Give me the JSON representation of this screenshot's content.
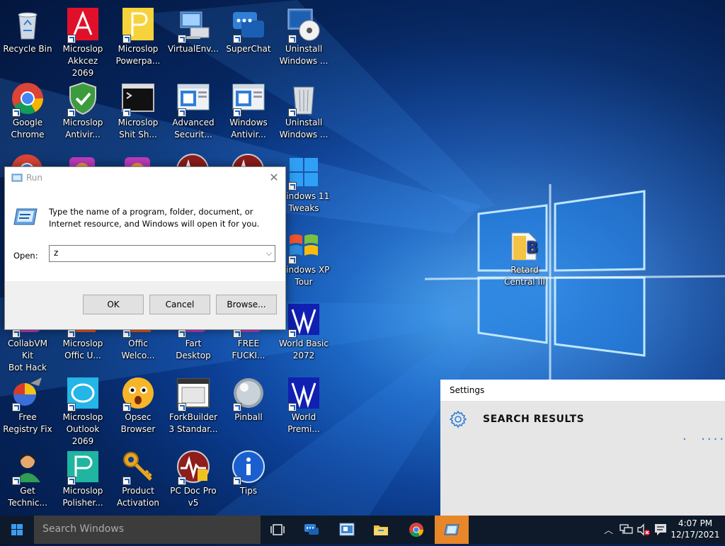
{
  "desktop": {
    "icons": [
      {
        "label": "Recycle Bin",
        "icon": "recycle-bin-icon"
      },
      {
        "label": "Microslop\nAkkcez 2069",
        "icon": "access-icon"
      },
      {
        "label": "Microslop\nPowerpa...",
        "icon": "powerpoint-icon"
      },
      {
        "label": "VirtualEnv...",
        "icon": "computer-icon"
      },
      {
        "label": "SuperChat",
        "icon": "chat-icon"
      },
      {
        "label": "Uninstall\nWindows ...",
        "icon": "uninstall-cd-icon"
      },
      {
        "label": "Google\nChrome",
        "icon": "chrome-icon"
      },
      {
        "label": "Microslop\nAntivir...",
        "icon": "shield-icon"
      },
      {
        "label": "Microslop\nShit Sh...",
        "icon": "terminal-icon"
      },
      {
        "label": "Advanced\nSecurit...",
        "icon": "window-app-icon"
      },
      {
        "label": "Windows\nAntivir...",
        "icon": "window-app-icon"
      },
      {
        "label": "Uninstall\nWindows ...",
        "icon": "trash-can-icon"
      },
      {
        "label": "Windows 11\nTweaks",
        "icon": "windows-logo-icon"
      },
      {
        "label": "Windows XP\nTour",
        "icon": "windows-xp-logo-icon"
      },
      {
        "label": "CollabVM Kit\nBot Hack",
        "icon": "app-icon"
      },
      {
        "label": "Microslop\nOffic U...",
        "icon": "office-icon"
      },
      {
        "label": "Offic\nWelco...",
        "icon": "office-icon"
      },
      {
        "label": "Fart Desktop",
        "icon": "app-icon"
      },
      {
        "label": "FREE\nFUCKI...",
        "icon": "app-icon"
      },
      {
        "label": "World Basic\n2072",
        "icon": "world-basic-icon"
      },
      {
        "label": "Free\nRegistry Fix",
        "icon": "registry-fix-icon"
      },
      {
        "label": "Microslop\nOutlook 2069",
        "icon": "outlook-icon"
      },
      {
        "label": "Opsec\nBrowser",
        "icon": "surprised-face-icon"
      },
      {
        "label": "ForkBuilder\n3 Standar...",
        "icon": "window-frame-icon"
      },
      {
        "label": "Pinball",
        "icon": "pinball-icon"
      },
      {
        "label": "World\nPremi...",
        "icon": "world-basic-icon"
      },
      {
        "label": "Get\nTechnic...",
        "icon": "support-person-icon"
      },
      {
        "label": "Microslop\nPolisher...",
        "icon": "polisher-icon"
      },
      {
        "label": "Product\nActivation",
        "icon": "key-icon"
      },
      {
        "label": "PC Doc Pro\nv5",
        "icon": "pc-doc-icon"
      },
      {
        "label": "Tips",
        "icon": "info-icon"
      },
      {
        "label": "Retard\nCentral III",
        "icon": "folder-icon"
      }
    ]
  },
  "run_dialog": {
    "title": "Run",
    "description": "Type the name of a program, folder, document, or Internet resource, and Windows will open it for you.",
    "open_label": "Open:",
    "open_value": "z",
    "ok_label": "OK",
    "cancel_label": "Cancel",
    "browse_label": "Browse..."
  },
  "settings_panel": {
    "title": "Settings",
    "results_heading": "SEARCH RESULTS"
  },
  "taskbar": {
    "search_placeholder": "Search Windows",
    "time": "4:07 PM",
    "date": "12/17/2021"
  },
  "colors": {
    "accent": "#e8862a",
    "taskbar": "#0e1a2a",
    "settings_dots": "#2f7fd8"
  }
}
